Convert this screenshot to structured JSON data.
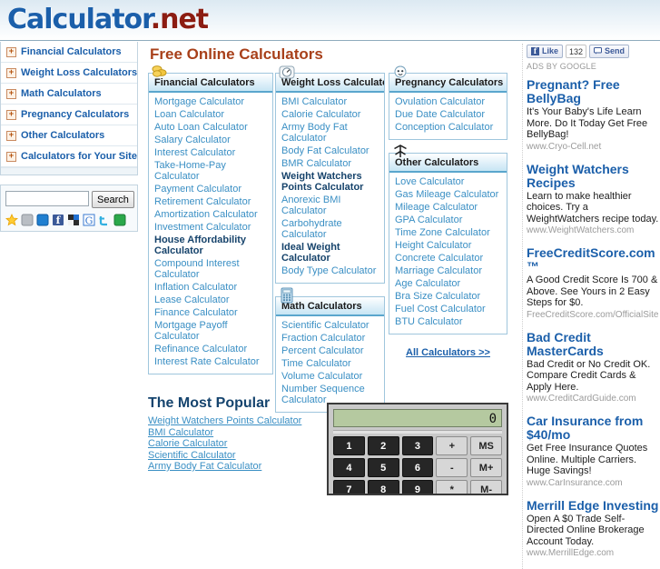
{
  "site": {
    "logo_main": "Calculator",
    "logo_tld": ".net"
  },
  "sidebar": {
    "items": [
      {
        "label": "Financial Calculators",
        "expander": "+"
      },
      {
        "label": "Weight Loss Calculators",
        "expander": "+"
      },
      {
        "label": "Math Calculators",
        "expander": "+"
      },
      {
        "label": "Pregnancy Calculators",
        "expander": "+"
      },
      {
        "label": "Other Calculators",
        "expander": "+"
      },
      {
        "label": "Calculators for Your Site",
        "expander": "+"
      }
    ],
    "search": {
      "value": "",
      "placeholder": "",
      "button_label": "Search"
    },
    "social_icons": [
      "favorites-star-icon",
      "myspace-icon",
      "windows-live-icon",
      "facebook-icon",
      "delicious-icon",
      "google-icon",
      "twitter-icon",
      "stumbleupon-icon"
    ]
  },
  "main": {
    "page_title": "Free Online Calculators",
    "all_calculators_link": "All Calculators >>",
    "boxes": [
      {
        "id": "financial",
        "title": "Financial Calculators",
        "icon": "coins-icon",
        "links": [
          {
            "label": "Mortgage Calculator",
            "bold": false
          },
          {
            "label": "Loan Calculator",
            "bold": false
          },
          {
            "label": "Auto Loan Calculator",
            "bold": false
          },
          {
            "label": "Salary Calculator",
            "bold": false
          },
          {
            "label": "Interest Calculator",
            "bold": false
          },
          {
            "label": "Take-Home-Pay Calculator",
            "bold": false
          },
          {
            "label": "Payment Calculator",
            "bold": false
          },
          {
            "label": "Retirement Calculator",
            "bold": false
          },
          {
            "label": "Amortization Calculator",
            "bold": false
          },
          {
            "label": "Investment Calculator",
            "bold": false
          },
          {
            "label": "House Affordability Calculator",
            "bold": true
          },
          {
            "label": "Compound Interest Calculator",
            "bold": false
          },
          {
            "label": "Inflation Calculator",
            "bold": false
          },
          {
            "label": "Lease Calculator",
            "bold": false
          },
          {
            "label": "Finance Calculator",
            "bold": false
          },
          {
            "label": "Mortgage Payoff Calculator",
            "bold": false
          },
          {
            "label": "Refinance Calculator",
            "bold": false
          },
          {
            "label": "Interest Rate Calculator",
            "bold": false
          }
        ]
      },
      {
        "id": "weight-loss",
        "title": "Weight Loss Calculators",
        "icon": "scale-icon",
        "links": [
          {
            "label": "BMI Calculator",
            "bold": false
          },
          {
            "label": "Calorie Calculator",
            "bold": false
          },
          {
            "label": "Army Body Fat Calculator",
            "bold": false
          },
          {
            "label": "Body Fat Calculator",
            "bold": false
          },
          {
            "label": "BMR Calculator",
            "bold": false
          },
          {
            "label": "Weight Watchers Points Calculator",
            "bold": true
          },
          {
            "label": "Anorexic BMI Calculator",
            "bold": false
          },
          {
            "label": "Carbohydrate Calculator",
            "bold": false
          },
          {
            "label": "Ideal Weight Calculator",
            "bold": true
          },
          {
            "label": "Body Type Calculator",
            "bold": false
          }
        ]
      },
      {
        "id": "math",
        "title": "Math Calculators",
        "icon": "calculator-icon",
        "links": [
          {
            "label": "Scientific Calculator",
            "bold": false
          },
          {
            "label": "Fraction Calculator",
            "bold": false
          },
          {
            "label": "Percent Calculator",
            "bold": false
          },
          {
            "label": "Time Calculator",
            "bold": false
          },
          {
            "label": "Volume Calculator",
            "bold": false
          },
          {
            "label": "Number Sequence Calculator",
            "bold": false
          }
        ]
      },
      {
        "id": "pregnancy",
        "title": "Pregnancy Calculators",
        "icon": "baby-icon",
        "links": [
          {
            "label": "Ovulation Calculator",
            "bold": false
          },
          {
            "label": "Due Date Calculator",
            "bold": false
          },
          {
            "label": "Conception Calculator",
            "bold": false
          }
        ]
      },
      {
        "id": "other",
        "title": "Other Calculators",
        "icon": "compass-icon",
        "links": [
          {
            "label": "Love Calculator",
            "bold": false
          },
          {
            "label": "Gas Mileage Calculator",
            "bold": false
          },
          {
            "label": "Mileage Calculator",
            "bold": false
          },
          {
            "label": "GPA Calculator",
            "bold": false
          },
          {
            "label": "Time Zone Calculator",
            "bold": false
          },
          {
            "label": "Height Calculator",
            "bold": false
          },
          {
            "label": "Concrete Calculator",
            "bold": false
          },
          {
            "label": "Marriage Calculator",
            "bold": false
          },
          {
            "label": "Age Calculator",
            "bold": false
          },
          {
            "label": "Bra Size Calculator",
            "bold": false
          },
          {
            "label": "Fuel Cost Calculator",
            "bold": false
          },
          {
            "label": "BTU Calculator",
            "bold": false
          }
        ]
      }
    ]
  },
  "popular": {
    "heading": "The Most Popular",
    "links": [
      "Weight Watchers Points Calculator",
      "BMI Calculator",
      "Calorie Calculator",
      "Scientific Calculator",
      "Army Body Fat Calculator"
    ]
  },
  "calculator_widget": {
    "display": "0",
    "keys": [
      {
        "label": "1",
        "type": "num"
      },
      {
        "label": "2",
        "type": "num"
      },
      {
        "label": "3",
        "type": "num"
      },
      {
        "label": "+",
        "type": "op"
      },
      {
        "label": "MS",
        "type": "op"
      },
      {
        "label": "4",
        "type": "num"
      },
      {
        "label": "5",
        "type": "num"
      },
      {
        "label": "6",
        "type": "num"
      },
      {
        "label": "-",
        "type": "op"
      },
      {
        "label": "M+",
        "type": "op"
      },
      {
        "label": "7",
        "type": "num"
      },
      {
        "label": "8",
        "type": "num"
      },
      {
        "label": "9",
        "type": "num"
      },
      {
        "label": "*",
        "type": "op"
      },
      {
        "label": "M-",
        "type": "op"
      }
    ]
  },
  "ads": {
    "facebook": {
      "like_label": "Like",
      "count": "132",
      "send_label": "Send"
    },
    "ads_by_label": "ADS BY GOOGLE",
    "items": [
      {
        "title": "Pregnant? Free BellyBag",
        "body": "It's Your Baby's Life Learn More. Do It Today Get Free BellyBag!",
        "url": "www.Cryo-Cell.net"
      },
      {
        "title": "Weight Watchers Recipes",
        "body": "Learn to make healthier choices. Try a WeightWatchers recipe today.",
        "url": "www.WeightWatchers.com"
      },
      {
        "title": "FreeCreditScore.com ™",
        "body": "A Good Credit Score Is 700 & Above. See Yours in 2 Easy Steps for $0.",
        "url": "FreeCreditScore.com/OfficialSite"
      },
      {
        "title": "Bad Credit MasterCards",
        "body": "Bad Credit or No Credit OK. Compare Credit Cards & Apply Here.",
        "url": "www.CreditCardGuide.com"
      },
      {
        "title": "Car Insurance from $40/mo",
        "body": "Get Free Insurance Quotes Online. Multiple Carriers. Huge Savings!",
        "url": "www.CarInsurance.com"
      },
      {
        "title": "Merrill Edge Investing",
        "body": "Open A $0 Trade Self-Directed Online Brokerage Account Today.",
        "url": "www.MerrillEdge.com"
      }
    ]
  },
  "colors": {
    "logo_blue": "#1b5faa",
    "logo_red": "#8c1d12",
    "title_orange": "#a8401a",
    "link_blue": "#3a8fc4",
    "box_border": "#9fc6dd",
    "facebook_blue": "#3b5998",
    "lcd_green": "#b5c9a0"
  }
}
